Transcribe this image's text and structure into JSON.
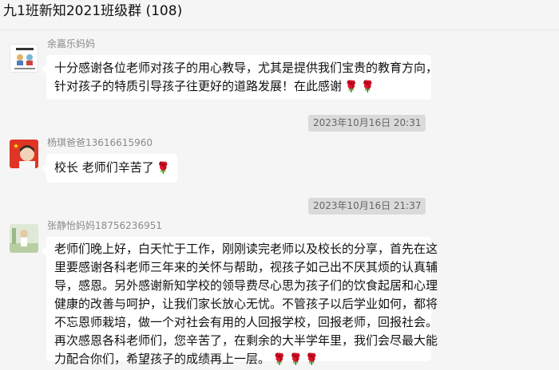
{
  "header": {
    "title": "九1班新知2021班级群 (108)"
  },
  "messages": [
    {
      "sender": "余嘉乐妈妈",
      "lines": [
        "十分感谢各位老师对孩子的用心教导，尤其是提供我们宝贵的教育方向，",
        "针对孩子的特质引导孩子往更好的道路发展！在此感谢"
      ],
      "emoji": "rose"
    },
    {
      "timestamp": "2023年10月16日 20:31",
      "sender": "杨琪爸爸13616615960",
      "lines": [
        "校长  老师们辛苦了"
      ],
      "emoji": "rose"
    },
    {
      "timestamp": "2023年10月16日 21:37",
      "sender": "张静怡妈妈18756236951",
      "lines": [
        "老师们晚上好，白天忙于工作，刚刚读完老师以及校长的分享，首先在这",
        "里要感谢各科老师三年来的关怀与帮助，视孩子如己出不厌其烦的认真辅",
        "导，感恩。另外感谢新知学校的领导费尽心思为孩子们的饮食起居和心理",
        "健康的改善与呵护，让我们家长放心无忧。不管孩子以后学业如何，都将",
        "不忘恩师栽培，做一个对社会有用的人回报学校，回报老师，回报社会。",
        "再次感恩各科老师们，您辛苦了，在剩余的大半学年里，我们会尽最大能",
        "力配合你们，希望孩子的成绩再上一层。"
      ],
      "emoji": "rose"
    }
  ]
}
